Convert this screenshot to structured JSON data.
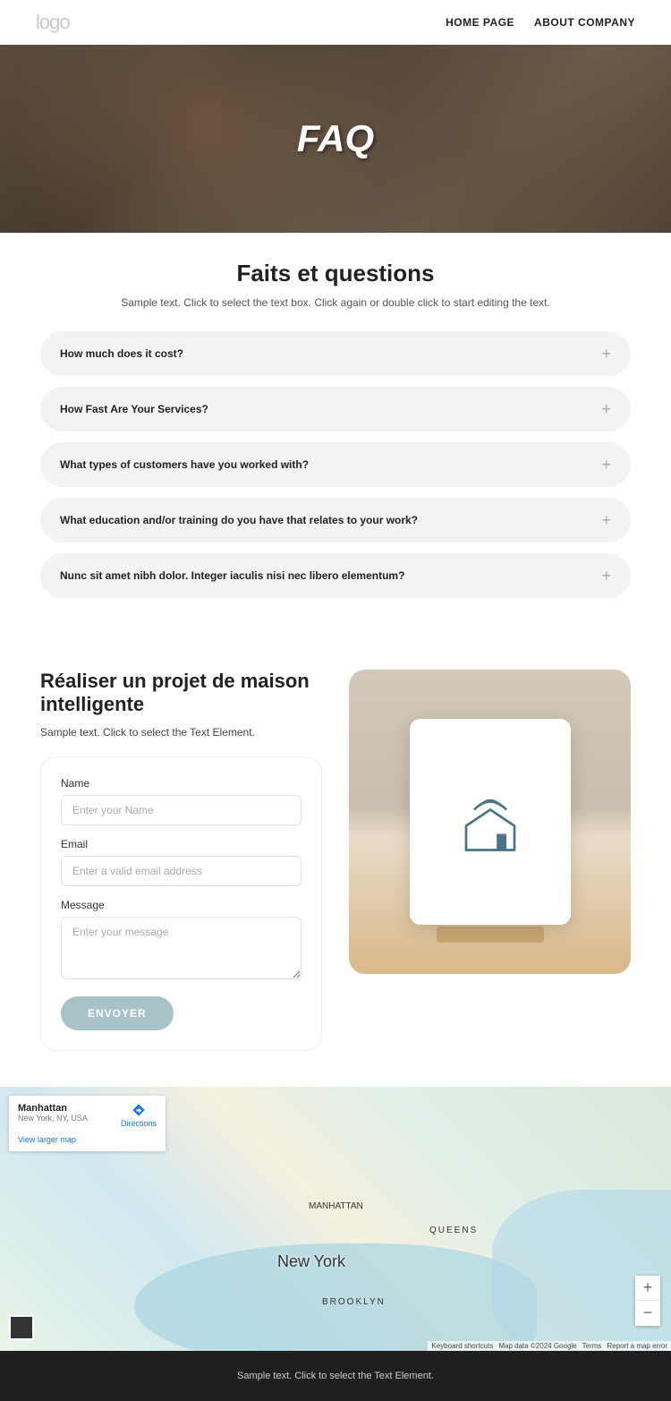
{
  "header": {
    "logo": "logo",
    "nav": {
      "home": "HOME PAGE",
      "about": "ABOUT COMPANY"
    }
  },
  "hero": {
    "title": "FAQ"
  },
  "faq": {
    "title": "Faits et questions",
    "subtitle": "Sample text. Click to select the text box. Click again or double click to start editing the text.",
    "items": [
      {
        "q": "How much does it cost?"
      },
      {
        "q": "How Fast Are Your Services?"
      },
      {
        "q": "What types of customers have you worked with?"
      },
      {
        "q": "What education and/or training do you have that relates to your work?"
      },
      {
        "q": "Nunc sit amet nibh dolor. Integer iaculis nisi nec libero elementum?"
      }
    ]
  },
  "contact": {
    "title": "Réaliser un projet de maison intelligente",
    "subtitle": "Sample text. Click to select the Text Element.",
    "form": {
      "name_label": "Name",
      "name_placeholder": "Enter your Name",
      "email_label": "Email",
      "email_placeholder": "Enter a valid email address",
      "message_label": "Message",
      "message_placeholder": "Enter your message",
      "submit": "ENVOYER"
    }
  },
  "map": {
    "card": {
      "title": "Manhattan",
      "subtitle": "New York, NY, USA",
      "directions": "Directions",
      "viewlarger": "View larger map"
    },
    "labels": {
      "newyork": "New York",
      "manhattan": "MANHATTAN",
      "brooklyn": "BROOKLYN",
      "queens": "QUEENS"
    },
    "attrib": {
      "shortcuts": "Keyboard shortcuts",
      "mapdata": "Map data ©2024 Google",
      "terms": "Terms",
      "report": "Report a map error"
    }
  },
  "footer": {
    "text": "Sample text. Click to select the Text Element."
  }
}
